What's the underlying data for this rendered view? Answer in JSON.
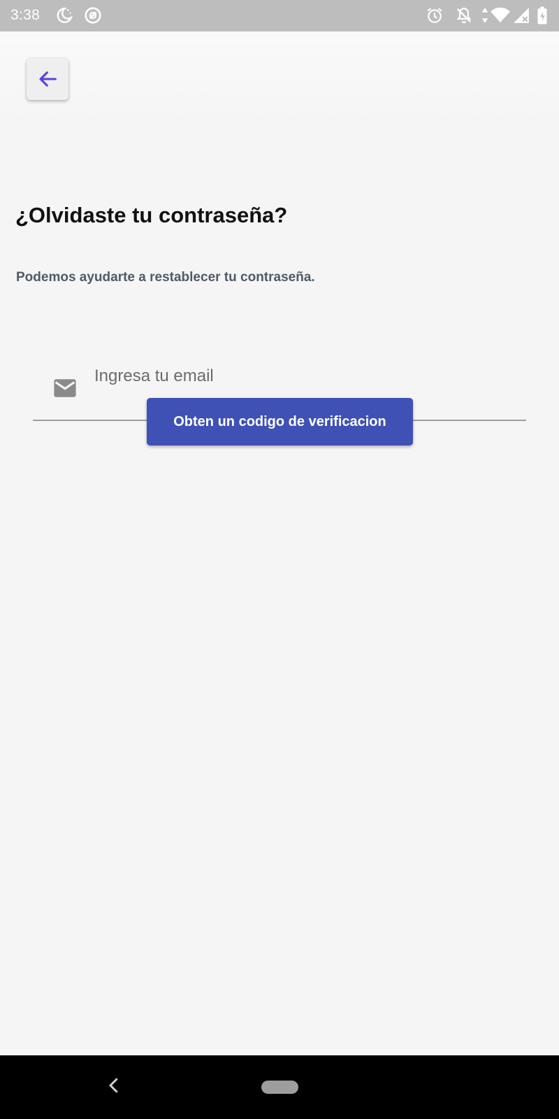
{
  "status_bar": {
    "time": "3:38",
    "icons": [
      "do-not-disturb-moon-icon",
      "at-sign-icon",
      "alarm-clock-icon",
      "notifications-off-icon",
      "data-arrows-icon",
      "wifi-icon",
      "cell-signal-icon",
      "battery-charging-icon"
    ]
  },
  "header": {
    "back_icon": "arrow-left-icon"
  },
  "main": {
    "title": "¿Olvidaste tu contraseña?",
    "subtitle": "Podemos ayudarte a restablecer tu contraseña.",
    "email_field": {
      "icon": "mail-icon",
      "placeholder": "Ingresa tu email",
      "value": ""
    },
    "verify_button_label": "Obten un codigo de verificacion"
  },
  "nav_bar": {
    "icons": [
      "nav-back-icon",
      "nav-home-pill"
    ]
  },
  "colors": {
    "accent": "#3f51b5",
    "back_arrow": "#5b3fe0",
    "status_bar": "#bdbdbd",
    "subtitle": "#4f5b68",
    "nav_bar": "#000000"
  }
}
